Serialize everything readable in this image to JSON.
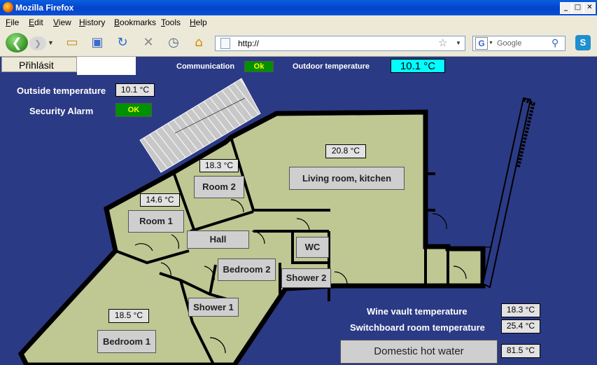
{
  "window": {
    "title": "Mozilla Firefox",
    "minimize": "_",
    "maximize": "□",
    "close": "✕"
  },
  "menu": [
    "File",
    "Edit",
    "View",
    "History",
    "Bookmarks",
    "Tools",
    "Help"
  ],
  "toolbar": {
    "url": "http://",
    "search_placeholder": "Google"
  },
  "page": {
    "login_label": "Přihlásit",
    "communication_label": "Communication",
    "communication_status": "Ok",
    "outdoor_temperature_label": "Outdoor temperature",
    "outdoor_temperature_value": "10.1 °C",
    "outside_temperature_label": "Outside temperature",
    "outside_temperature_value": "10.1 °C",
    "security_alarm_label": "Security Alarm",
    "security_alarm_status": "OK",
    "wine_vault_label": "Wine vault temperature",
    "wine_vault_value": "18.3 °C",
    "switchboard_label": "Switchboard room temperature",
    "switchboard_value": "25.4 °C",
    "hot_water_label": "Domestic hot water",
    "hot_water_value": "81.5 °C"
  },
  "rooms": {
    "living": {
      "name": "Living room, kitchen",
      "temp": "20.8 °C"
    },
    "room2": {
      "name": "Room 2",
      "temp": "18.3 °C"
    },
    "room1": {
      "name": "Room 1",
      "temp": "14.6 °C"
    },
    "hall": {
      "name": "Hall"
    },
    "wc": {
      "name": "WC"
    },
    "bedroom2": {
      "name": "Bedroom 2"
    },
    "shower2": {
      "name": "Shower 2"
    },
    "shower1": {
      "name": "Shower 1"
    },
    "bedroom1": {
      "name": "Bedroom 1",
      "temp": "18.5 °C"
    }
  },
  "colors": {
    "background": "#2b3a85",
    "floor": "#bfc793",
    "wall": "#000000",
    "ok_green": "#009000",
    "outdoor_cyan": "#00ffff"
  }
}
